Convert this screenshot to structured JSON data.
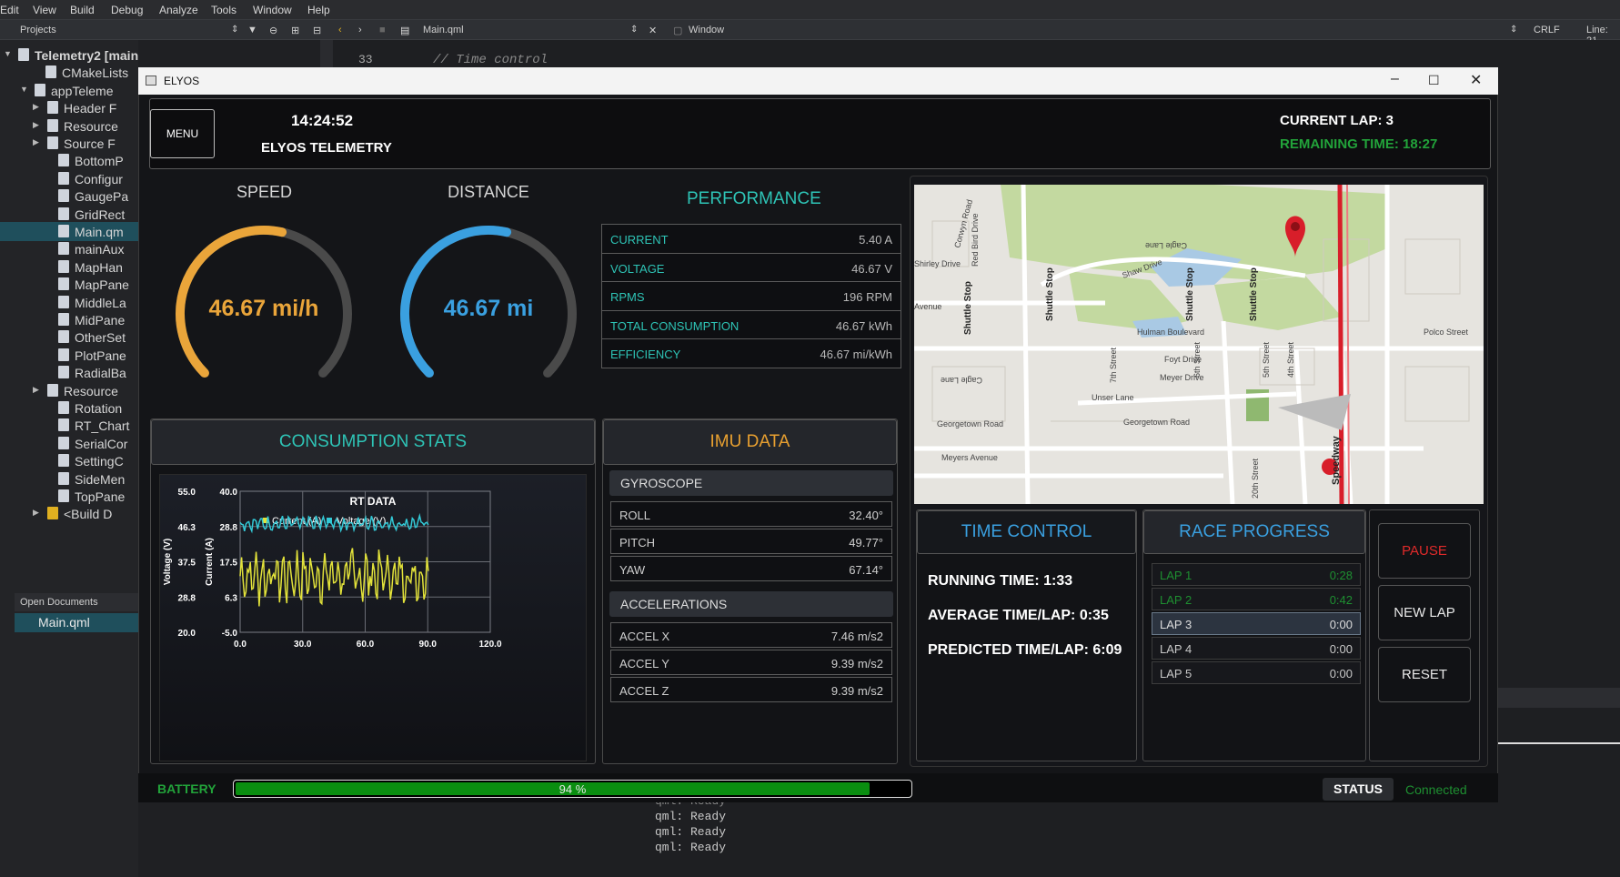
{
  "ide": {
    "menu": [
      "Edit",
      "View",
      "Build",
      "Debug",
      "Analyze",
      "Tools",
      "Window",
      "Help"
    ],
    "toolbar": {
      "projects": "Projects",
      "file": "Main.qml",
      "window_combo": "Window",
      "line_ending": "CRLF",
      "line": "Line: 21"
    },
    "tree": [
      {
        "label": "Telemetry2 [main]",
        "bold": true
      },
      {
        "label": "CMakeLists"
      },
      {
        "label": "appTeleme"
      },
      {
        "label": "Header F"
      },
      {
        "label": "Resource"
      },
      {
        "label": "Source F"
      },
      {
        "label": "BottomP"
      },
      {
        "label": "Configur"
      },
      {
        "label": "GaugePa"
      },
      {
        "label": "GridRect"
      },
      {
        "label": "Main.qm",
        "selected": true
      },
      {
        "label": "mainAux"
      },
      {
        "label": "MapHan"
      },
      {
        "label": "MapPane"
      },
      {
        "label": "MiddleLa"
      },
      {
        "label": "MidPane"
      },
      {
        "label": "OtherSet"
      },
      {
        "label": "PlotPane"
      },
      {
        "label": "RadialBa"
      },
      {
        "label": "Resource"
      },
      {
        "label": "Rotation"
      },
      {
        "label": "RT_Chart"
      },
      {
        "label": "SerialCor"
      },
      {
        "label": "SettingC"
      },
      {
        "label": "SideMen"
      },
      {
        "label": "TopPane"
      },
      {
        "label": "<Build D"
      }
    ],
    "open_documents_label": "Open Documents",
    "open_document": "Main.qml",
    "line_number": "33",
    "code_line": "// Time control",
    "console_lines": [
      "qml: Ready",
      "qml: Ready",
      "qml: Ready",
      "qml: Ready"
    ]
  },
  "window": {
    "title": "ELYOS"
  },
  "header": {
    "menu_label": "MENU",
    "time": "14:24:52",
    "app_title": "ELYOS TELEMETRY",
    "current_lap": "CURRENT LAP: 3",
    "remaining_time": "REMAINING TIME: 18:27"
  },
  "gauges": {
    "speed": {
      "title": "SPEED",
      "value": "46.67 mi/h",
      "fraction": 0.4667,
      "color": "#eaa53a"
    },
    "distance": {
      "title": "DISTANCE",
      "value": "46.67 mi",
      "fraction": 0.4667,
      "color": "#3aa0e0"
    }
  },
  "performance": {
    "title": "PERFORMANCE",
    "rows": [
      {
        "k": "CURRENT",
        "v": "5.40 A"
      },
      {
        "k": "VOLTAGE",
        "v": "46.67 V"
      },
      {
        "k": "RPMS",
        "v": "196 RPM"
      },
      {
        "k": "TOTAL CONSUMPTION",
        "v": "46.67 kWh"
      },
      {
        "k": "EFFICIENCY",
        "v": "46.67 mi/kWh"
      }
    ]
  },
  "consumption": {
    "title": "CONSUMPTION STATS"
  },
  "chart_data": {
    "type": "line",
    "title": "RT DATA",
    "series": [
      {
        "name": "Current (A)",
        "color": "#e2e23a",
        "axis": "Current (A)",
        "ylim": [
          -5.0,
          40.0
        ],
        "center": 13.0,
        "amp": 10.0
      },
      {
        "name": "Voltage (V)",
        "color": "#33c9d6",
        "axis": "Voltage (V)",
        "ylim": [
          20.0,
          55.0
        ],
        "center": 47.0,
        "amp": 2.0
      }
    ],
    "xlim": [
      0.0,
      120.0
    ],
    "x_ticks": [
      "0.0",
      "30.0",
      "60.0",
      "90.0",
      "120.0"
    ],
    "y_left_outer_ticks": [
      "55.0",
      "46.3",
      "37.5",
      "28.8",
      "20.0"
    ],
    "y_left_inner_ticks": [
      "40.0",
      "28.8",
      "17.5",
      "6.3",
      "-5.0"
    ],
    "ylabel_outer": "Voltage (V)",
    "ylabel_inner": "Current (A)",
    "x_end": 91,
    "legend": "top"
  },
  "imu": {
    "title": "IMU DATA",
    "gyro_label": "GYROSCOPE",
    "gyro": [
      {
        "k": "ROLL",
        "v": "32.40°"
      },
      {
        "k": "PITCH",
        "v": "49.77°"
      },
      {
        "k": "YAW",
        "v": "67.14°"
      }
    ],
    "accel_label": "ACCELERATIONS",
    "accel": [
      {
        "k": "ACCEL X",
        "v": "7.46 m/s2"
      },
      {
        "k": "ACCEL Y",
        "v": "9.39 m/s2"
      },
      {
        "k": "ACCEL Z",
        "v": "9.39 m/s2"
      }
    ]
  },
  "map": {
    "labels": [
      "Corwyn Road",
      "Red Bird Drive",
      "Cagle Lane",
      "Shirley Drive",
      "Shaw Drive",
      "Shuttle Stop",
      "Shuttle Stop",
      "Shuttle Stop",
      "Shuttle Stop",
      "Hulman Boulevard",
      "Polco Street",
      "Foyt Drive",
      "Meyer Drive",
      "Cagle Lane",
      "Unser Lane",
      "Georgetown Road",
      "Georgetown Road",
      "Meyers Avenue",
      "Speedway",
      "7th Street",
      "6th Street",
      "5th Street",
      "4th Street",
      "20th Street",
      "Avenue"
    ]
  },
  "time_control": {
    "title": "TIME CONTROL",
    "running": "RUNNING TIME:   1:33",
    "average": "AVERAGE TIME/LAP:   0:35",
    "predicted": "PREDICTED TIME/LAP:   6:09"
  },
  "race_progress": {
    "title": "RACE PROGRESS",
    "laps": [
      {
        "k": "LAP 1",
        "v": "0:28",
        "state": "done"
      },
      {
        "k": "LAP 2",
        "v": "0:42",
        "state": "done"
      },
      {
        "k": "LAP 3",
        "v": "0:00",
        "state": "current"
      },
      {
        "k": "LAP 4",
        "v": "0:00",
        "state": "todo"
      },
      {
        "k": "LAP 5",
        "v": "0:00",
        "state": "todo"
      }
    ]
  },
  "controls": {
    "pause": "PAUSE",
    "new_lap": "NEW LAP",
    "reset": "RESET"
  },
  "bottom": {
    "battery_label": "BATTERY",
    "battery_text": "94 %",
    "battery_fraction": 0.94,
    "status_label": "STATUS",
    "status_value": "Connected"
  }
}
